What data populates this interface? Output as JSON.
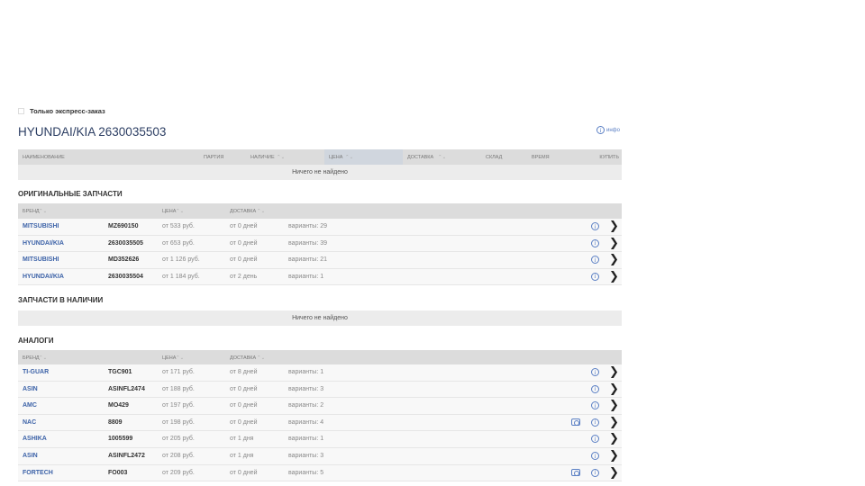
{
  "express_label": "Только экспресс-заказ",
  "title": "HYUNDAI/KIA 2630035503",
  "info_label": "инфо",
  "main_table": {
    "headers": [
      "Наименование",
      "Партия",
      "Наличие",
      "Цена",
      "Доставка",
      "Склад",
      "Время",
      "Купить"
    ],
    "empty": "Ничего не найдено"
  },
  "sort_arrows": "⌃⌄",
  "originals": {
    "title": "ОРИГИНАЛЬНЫЕ ЗАПЧАСТИ",
    "headers": [
      "Бренд",
      "Цена",
      "Доставка"
    ],
    "rows": [
      {
        "brand": "MITSUBISHI",
        "article": "MZ690150",
        "price": "от 533 руб.",
        "delivery": "от 0 дней",
        "variants": "варианты: 29",
        "photo": false
      },
      {
        "brand": "HYUNDAI/KIA",
        "article": "2630035505",
        "price": "от 653 руб.",
        "delivery": "от 0 дней",
        "variants": "варианты: 39",
        "photo": false
      },
      {
        "brand": "MITSUBISHI",
        "article": "MD352626",
        "price": "от 1 126 руб.",
        "delivery": "от 0 дней",
        "variants": "варианты: 21",
        "photo": false
      },
      {
        "brand": "HYUNDAI/KIA",
        "article": "2630035504",
        "price": "от 1 184 руб.",
        "delivery": "от 2 день",
        "variants": "варианты: 1",
        "photo": false
      }
    ]
  },
  "in_stock": {
    "title": "ЗАПЧАСТИ В НАЛИЧИИ",
    "empty": "Ничего не найдено"
  },
  "analogs": {
    "title": "АНАЛОГИ",
    "headers": [
      "Бренд",
      "Цена",
      "Доставка"
    ],
    "rows": [
      {
        "brand": "TI-GUAR",
        "article": "TGC901",
        "price": "от 171 руб.",
        "delivery": "от 8 дней",
        "variants": "варианты: 1",
        "photo": false
      },
      {
        "brand": "ASIN",
        "article": "ASINFL2474",
        "price": "от 188 руб.",
        "delivery": "от 0 дней",
        "variants": "варианты: 3",
        "photo": false
      },
      {
        "brand": "AMC",
        "article": "MO429",
        "price": "от 197 руб.",
        "delivery": "от 0 дней",
        "variants": "варианты: 2",
        "photo": false
      },
      {
        "brand": "NAC",
        "article": "8809",
        "price": "от 198 руб.",
        "delivery": "от 0 дней",
        "variants": "варианты: 4",
        "photo": true
      },
      {
        "brand": "ASHIKA",
        "article": "1005599",
        "price": "от 205 руб.",
        "delivery": "от 1 дня",
        "variants": "варианты: 1",
        "photo": false
      },
      {
        "brand": "ASIN",
        "article": "ASINFL2472",
        "price": "от 208 руб.",
        "delivery": "от 1 дня",
        "variants": "варианты: 3",
        "photo": false
      },
      {
        "brand": "FORTECH",
        "article": "FO003",
        "price": "от 209 руб.",
        "delivery": "от 0 дней",
        "variants": "варианты: 5",
        "photo": true
      }
    ]
  }
}
